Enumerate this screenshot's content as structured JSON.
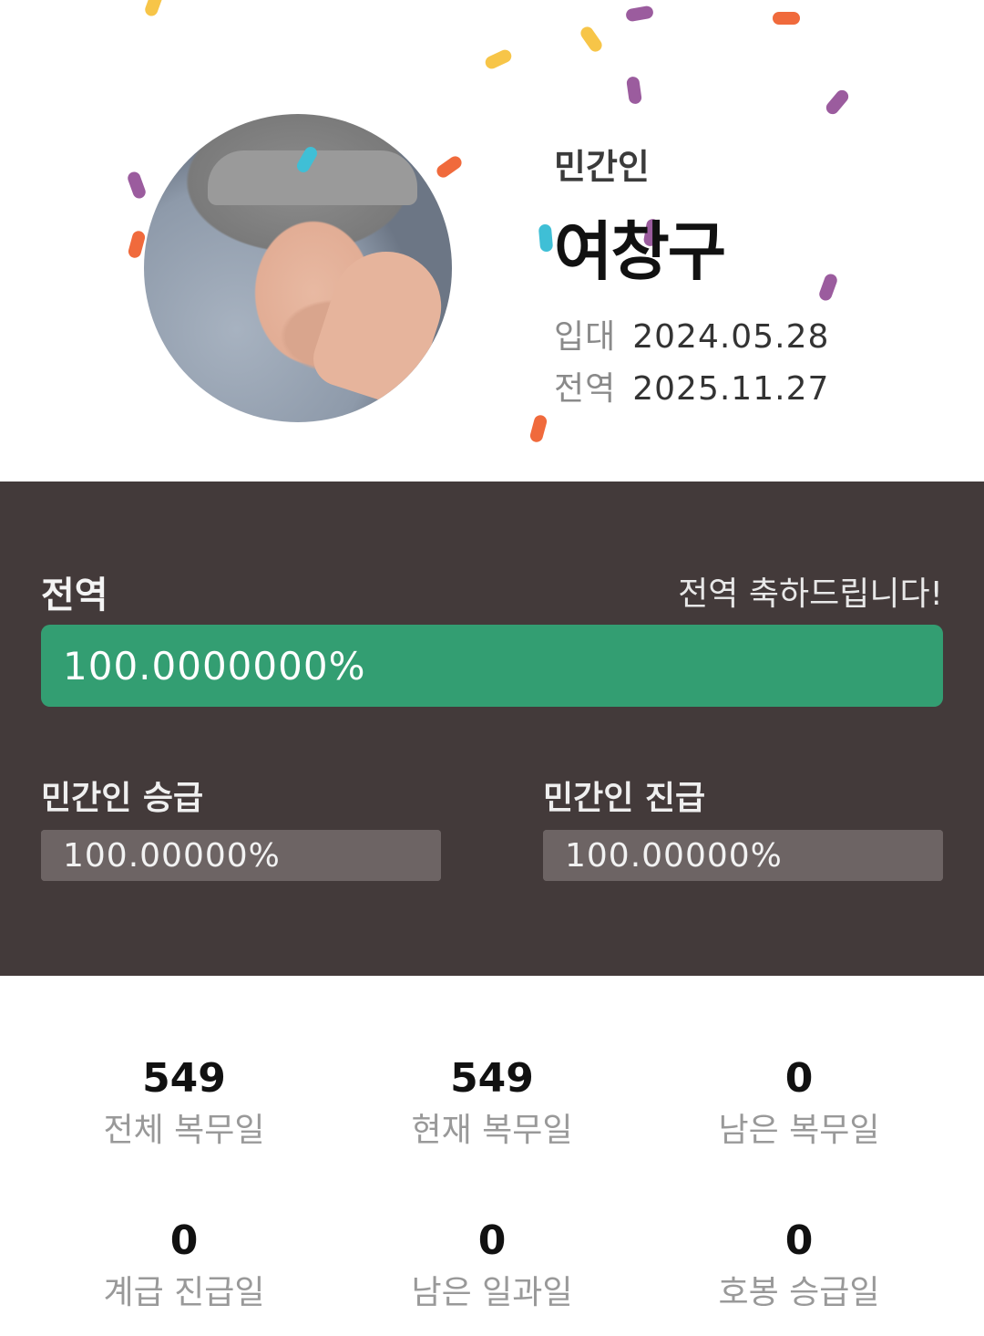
{
  "profile": {
    "status_label": "민간인",
    "name": "여창구",
    "enlist_label": "입대",
    "enlist_date": "2024.05.28",
    "discharge_label": "전역",
    "discharge_date": "2025.11.27"
  },
  "progress": {
    "title": "전역",
    "message": "전역 축하드립니다!",
    "main_text": "100.0000000%",
    "main_fraction": 1.0,
    "main_color": "#339e72",
    "promotion_label": "민간인 승급",
    "promotion_text": "100.00000%",
    "promotion_fraction": 1.0,
    "rank_up_label": "민간인 진급",
    "rank_up_text": "100.00000%",
    "rank_up_fraction": 1.0
  },
  "stats": [
    {
      "value": "549",
      "caption": "전체 복무일"
    },
    {
      "value": "549",
      "caption": "현재 복무일"
    },
    {
      "value": "0",
      "caption": "남은 복무일"
    },
    {
      "value": "0",
      "caption": "계급 진급일"
    },
    {
      "value": "0",
      "caption": "남은 일과일"
    },
    {
      "value": "0",
      "caption": "호봉 승급일"
    }
  ],
  "colors": {
    "panel_bg": "#433a3a",
    "confetti": [
      "#f7c548",
      "#9b5c9e",
      "#f06a3c",
      "#3fbfd6"
    ]
  }
}
